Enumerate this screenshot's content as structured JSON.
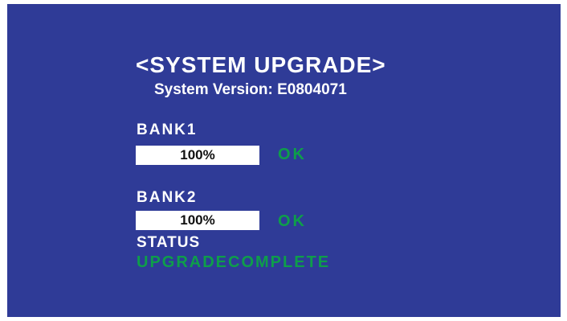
{
  "screen": {
    "title": "<SYSTEM UPGRADE>",
    "version": "System Version: E0804071",
    "colors": {
      "background": "#2f3b97",
      "text": "#ffffff",
      "ok_green": "#0e9e4a"
    }
  },
  "banks": [
    {
      "label": "BANK1",
      "progress_text": "100%",
      "progress_fraction": 1.0,
      "state": "OK"
    },
    {
      "label": "BANK2",
      "progress_text": "100%",
      "progress_fraction": 1.0,
      "state": "OK"
    }
  ],
  "status": {
    "label": "STATUS",
    "value": "UPGRADECOMPLETE"
  }
}
